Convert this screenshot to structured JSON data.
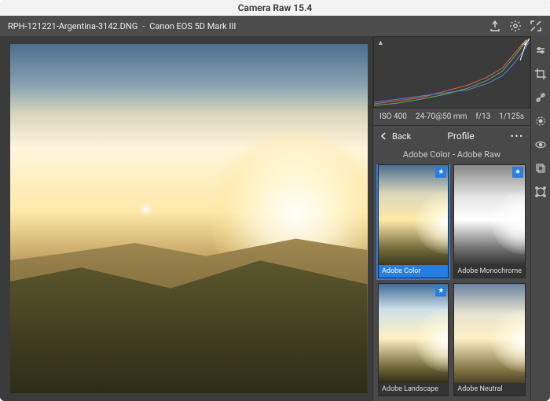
{
  "app": {
    "title": "Camera Raw 15.4"
  },
  "file": {
    "name": "RPH-121221-Argentina-3142.DNG",
    "separator": "  -  ",
    "camera": "Canon EOS 5D Mark III"
  },
  "meta": {
    "iso": "ISO 400",
    "lens": "24-70@50 mm",
    "aperture": "f/13",
    "shutter": "1/125s"
  },
  "panel": {
    "back_label": "Back",
    "title": "Profile",
    "subtitle": "Adobe Color - Adobe Raw"
  },
  "profiles": [
    {
      "label": "Adobe Color",
      "style": "color",
      "selected": true,
      "starred": true
    },
    {
      "label": "Adobe Monochrome",
      "style": "mono",
      "selected": false,
      "starred": true
    },
    {
      "label": "Adobe Landscape",
      "style": "landscape",
      "selected": false,
      "starred": true
    },
    {
      "label": "Adobe Neutral",
      "style": "neutral",
      "selected": false,
      "starred": false
    }
  ],
  "toolbar_icons": [
    "export-icon",
    "settings-icon",
    "fullscreen-icon"
  ],
  "rail_icons": [
    "edit-icon",
    "crop-icon",
    "heal-icon",
    "mask-icon",
    "redeye-icon",
    "preset-stack-icon",
    "more-tools-icon"
  ],
  "histogram": {
    "clip_left": "▲",
    "clip_right": "◢"
  }
}
